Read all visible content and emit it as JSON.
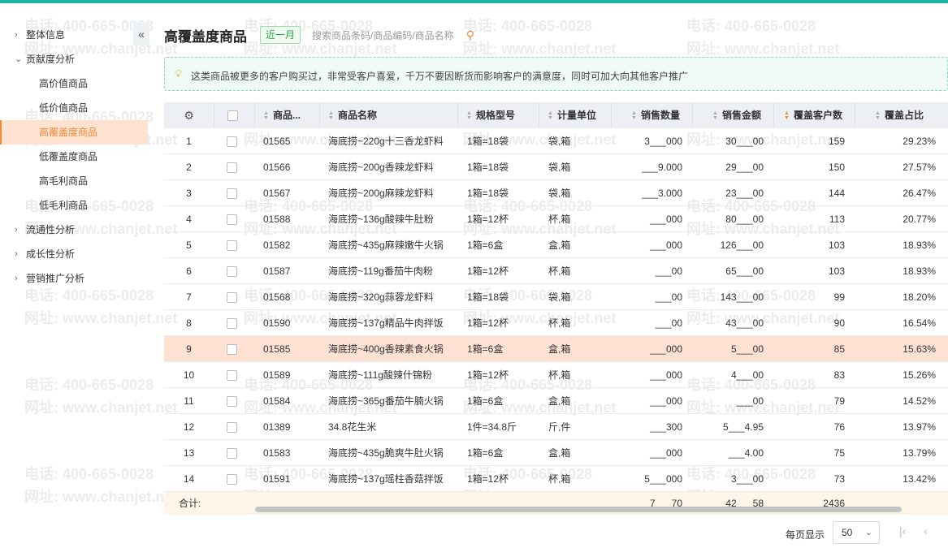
{
  "sidebar": {
    "collapse_icon": "double-chevron-left-icon",
    "items": [
      {
        "label": "整体信息",
        "level": 1,
        "expanded": false
      },
      {
        "label": "贡献度分析",
        "level": 1,
        "expanded": true
      },
      {
        "label": "高价值商品",
        "level": 2
      },
      {
        "label": "低价值商品",
        "level": 2
      },
      {
        "label": "高覆盖度商品",
        "level": 2,
        "active": true
      },
      {
        "label": "低覆盖度商品",
        "level": 2
      },
      {
        "label": "高毛利商品",
        "level": 2
      },
      {
        "label": "低毛利商品",
        "level": 2
      },
      {
        "label": "流通性分析",
        "level": 1,
        "expanded": false
      },
      {
        "label": "成长性分析",
        "level": 1,
        "expanded": false
      },
      {
        "label": "营销推广分析",
        "level": 1,
        "expanded": false
      }
    ]
  },
  "header": {
    "title": "高覆盖度商品",
    "period": "近一月",
    "search_placeholder": "搜索商品条码/商品编码/商品名称"
  },
  "tip": {
    "icon": "lightbulb-icon",
    "text": "这类商品被更多的客户购买过，非常受客户喜爱，千万不要因断货而影响客户的满意度，同时可加大向其他客户推广"
  },
  "table": {
    "settings_icon": "gear-icon",
    "columns": [
      "商品...",
      "商品名称",
      "规格型号",
      "计量单位",
      "销售数量",
      "销售金额",
      "覆盖客户数",
      "覆盖占比"
    ],
    "rows": [
      {
        "idx": "1",
        "code": "01565",
        "name": "海底捞~220g十三香龙虾料",
        "spec": "1箱=18袋",
        "unit": "袋,箱",
        "qty": "3___000",
        "amt": "30___00",
        "cust": "159",
        "ratio": "29.23%"
      },
      {
        "idx": "2",
        "code": "01566",
        "name": "海底捞~200g香辣龙虾料",
        "spec": "1箱=18袋",
        "unit": "袋,箱",
        "qty": "___9.000",
        "amt": "29___00",
        "cust": "150",
        "ratio": "27.57%"
      },
      {
        "idx": "3",
        "code": "01567",
        "name": "海底捞~200g麻辣龙虾料",
        "spec": "1箱=18袋",
        "unit": "袋,箱",
        "qty": "___3.000",
        "amt": "23___00",
        "cust": "144",
        "ratio": "26.47%"
      },
      {
        "idx": "4",
        "code": "01588",
        "name": "海底捞~136g酸辣牛肚粉",
        "spec": "1箱=12杯",
        "unit": "杯,箱",
        "qty": "___000",
        "amt": "80___00",
        "cust": "113",
        "ratio": "20.77%"
      },
      {
        "idx": "5",
        "code": "01582",
        "name": "海底捞~435g麻辣嫩牛火锅",
        "spec": "1箱=6盒",
        "unit": "盒,箱",
        "qty": "___000",
        "amt": "126___00",
        "cust": "103",
        "ratio": "18.93%"
      },
      {
        "idx": "6",
        "code": "01587",
        "name": "海底捞~119g番茄牛肉粉",
        "spec": "1箱=12杯",
        "unit": "杯,箱",
        "qty": "___00",
        "amt": "65___00",
        "cust": "103",
        "ratio": "18.93%"
      },
      {
        "idx": "7",
        "code": "01568",
        "name": "海底捞~320g蒜蓉龙虾料",
        "spec": "1箱=18袋",
        "unit": "袋,箱",
        "qty": "___00",
        "amt": "143___00",
        "cust": "99",
        "ratio": "18.20%"
      },
      {
        "idx": "8",
        "code": "01590",
        "name": "海底捞~137g精品牛肉拌饭",
        "spec": "1箱=12杯",
        "unit": "杯,箱",
        "qty": "___00",
        "amt": "43___00",
        "cust": "90",
        "ratio": "16.54%"
      },
      {
        "idx": "9",
        "code": "01585",
        "name": "海底捞~400g香辣素食火锅",
        "spec": "1箱=6盒",
        "unit": "盒,箱",
        "qty": "___000",
        "amt": "5___00",
        "cust": "85",
        "ratio": "15.63%",
        "highlight": true
      },
      {
        "idx": "10",
        "code": "01589",
        "name": "海底捞~111g酸辣什锦粉",
        "spec": "1箱=12杯",
        "unit": "杯,箱",
        "qty": "___000",
        "amt": "4___00",
        "cust": "83",
        "ratio": "15.26%"
      },
      {
        "idx": "11",
        "code": "01584",
        "name": "海底捞~365g番茄牛腩火锅",
        "spec": "1箱=6盒",
        "unit": "盒,箱",
        "qty": "___000",
        "amt": "___00",
        "cust": "79",
        "ratio": "14.52%"
      },
      {
        "idx": "12",
        "code": "01389",
        "name": "34.8花生米",
        "spec": "1件=34.8斤",
        "unit": "斤,件",
        "qty": "___300",
        "amt": "5___4.95",
        "cust": "76",
        "ratio": "13.97%"
      },
      {
        "idx": "13",
        "code": "01583",
        "name": "海底捞~435g脆爽牛肚火锅",
        "spec": "1箱=6盒",
        "unit": "盒,箱",
        "qty": "___000",
        "amt": "___4.00",
        "cust": "75",
        "ratio": "13.79%"
      },
      {
        "idx": "14",
        "code": "01591",
        "name": "海底捞~137g瑶柱香菇拌饭",
        "spec": "1箱=12杯",
        "unit": "杯,箱",
        "qty": "5___000",
        "amt": "3___00",
        "cust": "73",
        "ratio": "13.42%"
      }
    ],
    "summary": {
      "label": "合计:",
      "qty": "7___70",
      "amt": "42___58",
      "cust": "2436"
    }
  },
  "pager": {
    "per_page_label": "每页显示",
    "per_page_value": "50",
    "first_icon": "first-page-icon",
    "prev_icon": "prev-page-icon"
  },
  "watermark": {
    "phone": "电话: 400-665-0028",
    "site": "网址: www.chanjet.net"
  }
}
